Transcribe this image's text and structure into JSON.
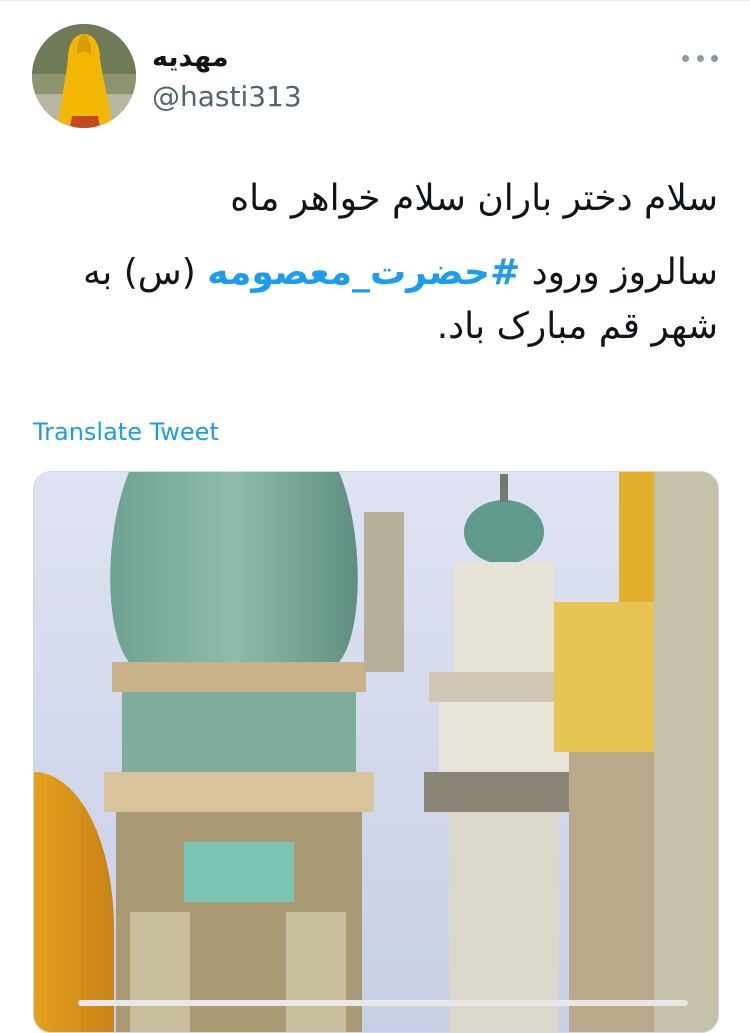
{
  "tweet": {
    "author": {
      "display_name": "مهدیه",
      "handle": "@hasti313",
      "avatar_icon": "avatar-woman-yellow-chador"
    },
    "more_icon": "more-dots-icon",
    "text_lines": [
      "سلام دختر باران سلام خواهر ماه",
      "سالروز ورود",
      "#حضرت_معصومه",
      "(س) به شهر قم مبارک باد."
    ],
    "translate_label": "Translate Tweet",
    "media": {
      "description_icon": "shrine-minarets-image"
    }
  },
  "colors": {
    "link": "#1d9bf0",
    "text": "#0f1419",
    "secondary": "#536471"
  }
}
